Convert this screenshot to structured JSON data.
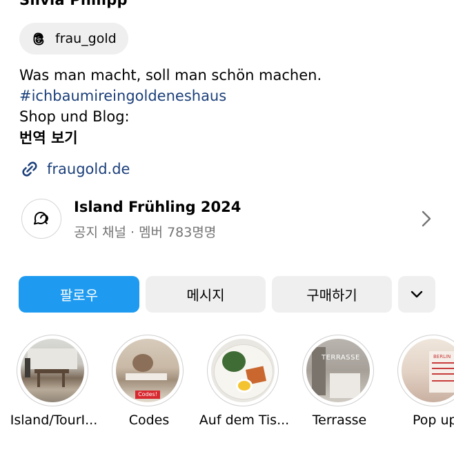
{
  "profile": {
    "name": "Silvia Philipp",
    "threads_handle": "frau_gold",
    "bio_line1": "Was man macht, soll man schön machen.",
    "bio_hashtag": "#ichbaumireingoldeneshaus",
    "bio_line3": "Shop und Blog:",
    "translate_label": "번역 보기",
    "link_label": "fraugold.de"
  },
  "channel": {
    "title": "Island Frühling 2024",
    "subtitle": "공지 채널 · 멤버 783명명"
  },
  "actions": {
    "follow": "팔로우",
    "message": "메시지",
    "shop": "구매하기"
  },
  "highlights": [
    {
      "label": "Island/TourI..."
    },
    {
      "label": "Codes",
      "badge": "Codes!"
    },
    {
      "label": "Auf dem Tis..."
    },
    {
      "label": "Terrasse",
      "overlay": "TERRASSE"
    },
    {
      "label": "Pop up",
      "overlay": "BERLIN"
    }
  ],
  "colors": {
    "accent": "#1e9bf0",
    "link": "#1b3f7a",
    "chip_bg": "#efefef",
    "muted": "#737373"
  }
}
